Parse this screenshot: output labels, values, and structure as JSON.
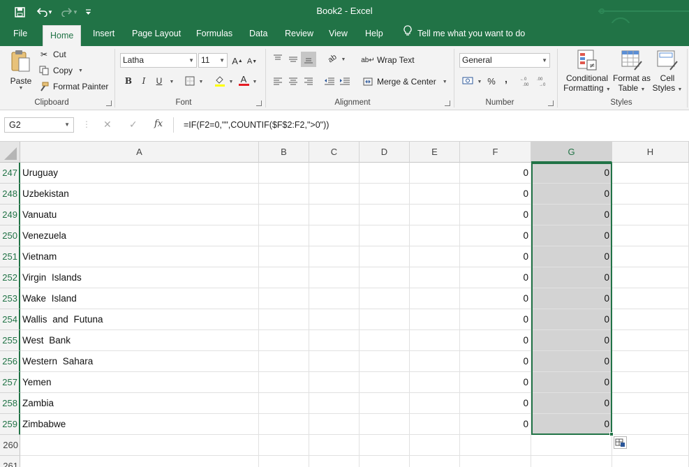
{
  "titlebar": {
    "title": "Book2  -  Excel",
    "qa_icons": [
      "save-icon",
      "undo-icon",
      "undo-dropdown-icon",
      "redo-icon",
      "redo-dropdown-icon",
      "customize-qat-icon"
    ]
  },
  "menu": {
    "tabs": [
      "File",
      "Home",
      "Insert",
      "Page Layout",
      "Formulas",
      "Data",
      "Review",
      "View",
      "Help"
    ],
    "active_tab": "Home",
    "tell_me": "Tell me what you want to do"
  },
  "ribbon": {
    "clipboard": {
      "paste": "Paste",
      "cut": "Cut",
      "copy": "Copy",
      "format_painter": "Format Painter",
      "label": "Clipboard"
    },
    "font": {
      "family": "Latha",
      "size": "11",
      "bold": "B",
      "italic": "I",
      "underline": "U",
      "label": "Font"
    },
    "alignment": {
      "wrap_text": "Wrap Text",
      "merge_center": "Merge & Center",
      "label": "Alignment"
    },
    "number": {
      "format": "General",
      "percent": "%",
      "comma": ",",
      "label": "Number"
    },
    "styles": {
      "conditional_1": "Conditional",
      "conditional_2": "Formatting",
      "format_table_1": "Format as",
      "format_table_2": "Table",
      "cell_styles_1": "Cell",
      "cell_styles_2": "Styles",
      "label": "Styles"
    }
  },
  "formula_bar": {
    "name_box": "G2",
    "formula": "=IF(F2=0,\"\",COUNTIF($F$2:F2,\">0\"))"
  },
  "sheet": {
    "columns": [
      "A",
      "B",
      "C",
      "D",
      "E",
      "F",
      "G",
      "H"
    ],
    "selected_column": "G",
    "rows": [
      {
        "num": "247",
        "a": "Uruguay",
        "f": "0",
        "g": "0"
      },
      {
        "num": "248",
        "a": "Uzbekistan",
        "f": "0",
        "g": "0"
      },
      {
        "num": "249",
        "a": "Vanuatu",
        "f": "0",
        "g": "0"
      },
      {
        "num": "250",
        "a": "Venezuela",
        "f": "0",
        "g": "0"
      },
      {
        "num": "251",
        "a": "Vietnam",
        "f": "0",
        "g": "0"
      },
      {
        "num": "252",
        "a": "Virgin Islands",
        "f": "0",
        "g": "0"
      },
      {
        "num": "253",
        "a": "Wake Island",
        "f": "0",
        "g": "0"
      },
      {
        "num": "254",
        "a": "Wallis and Futuna",
        "f": "0",
        "g": "0"
      },
      {
        "num": "255",
        "a": "West Bank",
        "f": "0",
        "g": "0"
      },
      {
        "num": "256",
        "a": "Western Sahara",
        "f": "0",
        "g": "0"
      },
      {
        "num": "257",
        "a": "Yemen",
        "f": "0",
        "g": "0"
      },
      {
        "num": "258",
        "a": "Zambia",
        "f": "0",
        "g": "0"
      },
      {
        "num": "259",
        "a": "Zimbabwe",
        "f": "0",
        "g": "0"
      },
      {
        "num": "260",
        "a": "",
        "f": "",
        "g": ""
      },
      {
        "num": "261",
        "a": "",
        "f": "",
        "g": ""
      }
    ]
  },
  "colors": {
    "excel_green": "#217346",
    "selection_gray": "#d3d3d3"
  }
}
